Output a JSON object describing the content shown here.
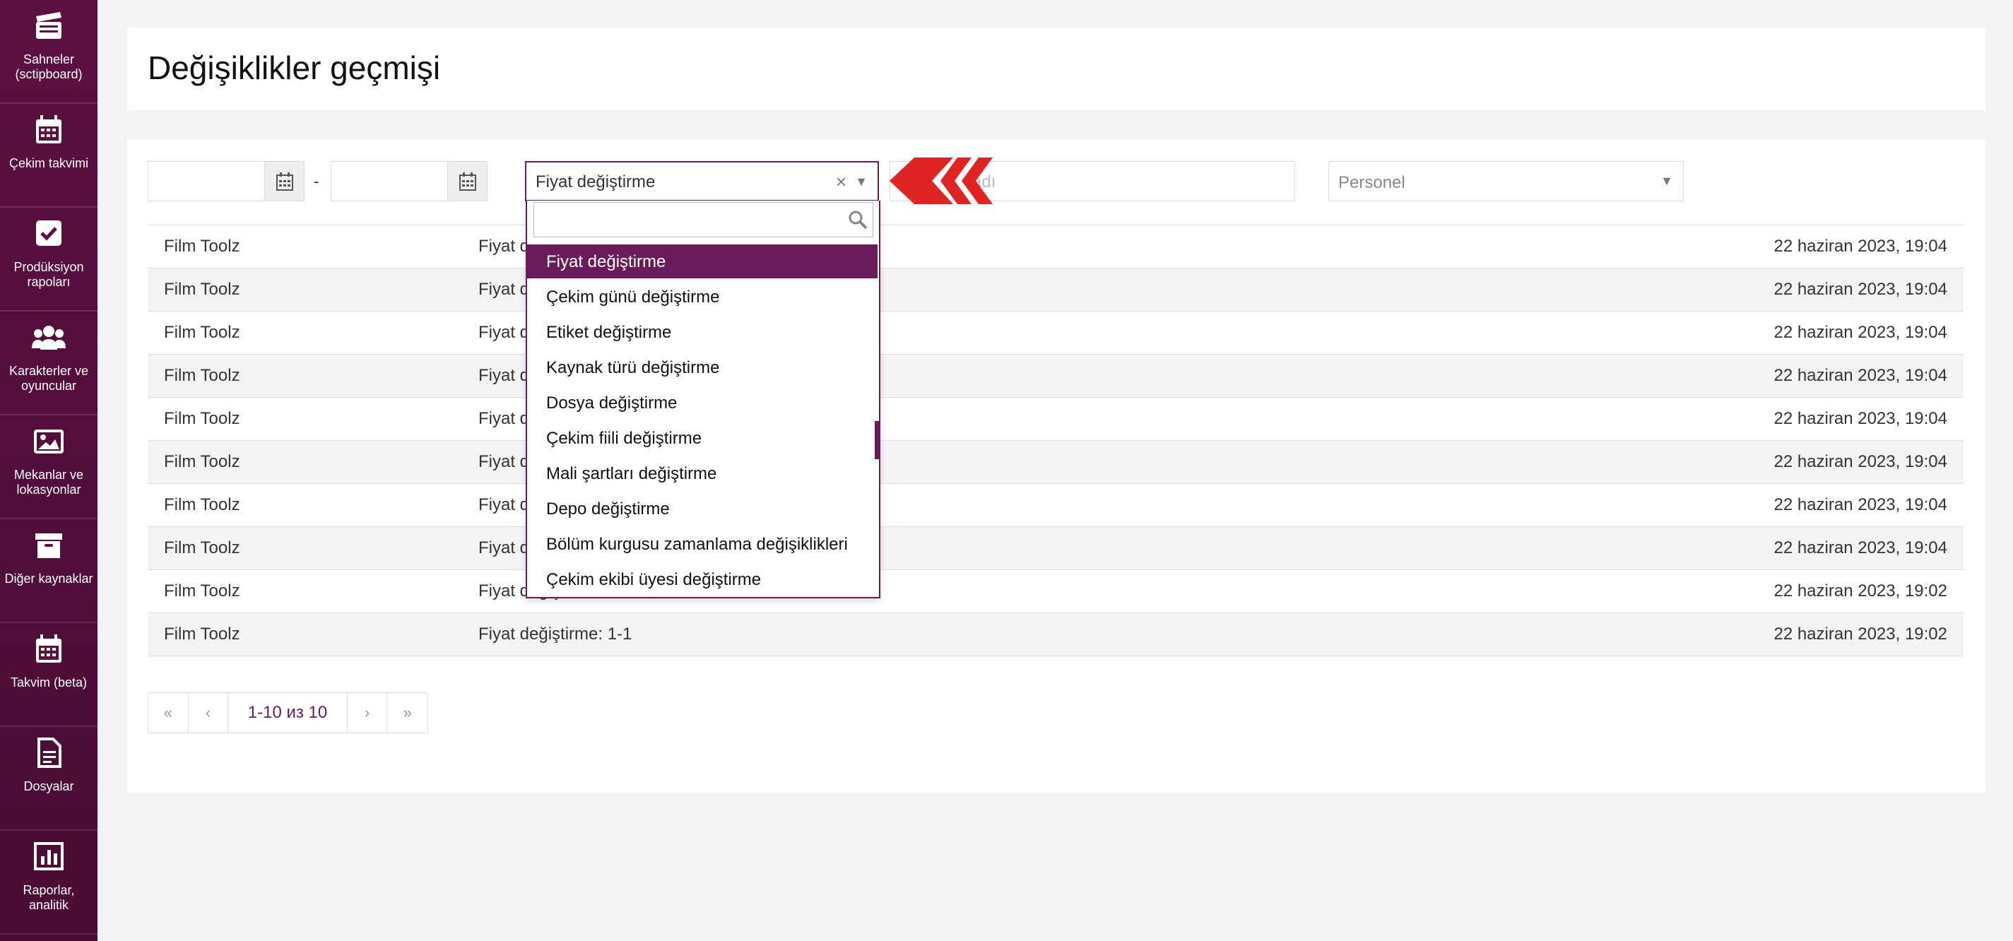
{
  "sidebar": {
    "items": [
      {
        "label": "Sahneler (sctipboard)",
        "icon": "clapperboard-icon"
      },
      {
        "label": "Çekim takvimi",
        "icon": "calendar-icon"
      },
      {
        "label": "Prodüksiyon rapoları",
        "icon": "checkbox-icon"
      },
      {
        "label": "Karakterler ve oyuncular",
        "icon": "users-icon"
      },
      {
        "label": "Mekanlar ve lokasyonlar",
        "icon": "image-icon"
      },
      {
        "label": "Diğer kaynaklar",
        "icon": "archive-box-icon"
      },
      {
        "label": "Takvim (beta)",
        "icon": "calendar-icon"
      },
      {
        "label": "Dosyalar",
        "icon": "document-icon"
      },
      {
        "label": "Raporlar, analitik",
        "icon": "bar-chart-icon"
      }
    ]
  },
  "header": {
    "title": "Değişiklikler geçmişi"
  },
  "filters": {
    "date_from": "",
    "date_separator": "-",
    "date_to": "",
    "type_select_value": "Fiyat değiştirme",
    "location_placeholder": "Mekan adı",
    "location_placeholder_visible": "adı",
    "staff_placeholder": "Personel"
  },
  "table": {
    "rows": [
      {
        "user": "Film Toolz",
        "action": "Fiyat d",
        "date": "22 haziran 2023, 19:04"
      },
      {
        "user": "Film Toolz",
        "action": "Fiyat d",
        "date": "22 haziran 2023, 19:04"
      },
      {
        "user": "Film Toolz",
        "action": "Fiyat d",
        "date": "22 haziran 2023, 19:04"
      },
      {
        "user": "Film Toolz",
        "action": "Fiyat d",
        "date": "22 haziran 2023, 19:04"
      },
      {
        "user": "Film Toolz",
        "action": "Fiyat d",
        "date": "22 haziran 2023, 19:04"
      },
      {
        "user": "Film Toolz",
        "action": "Fiyat d",
        "date": "22 haziran 2023, 19:04"
      },
      {
        "user": "Film Toolz",
        "action": "Fiyat d",
        "date": "22 haziran 2023, 19:04"
      },
      {
        "user": "Film Toolz",
        "action": "Fiyat d",
        "date": "22 haziran 2023, 19:04"
      },
      {
        "user": "Film Toolz",
        "action": "Fiyat değiştirme: 1-1",
        "date": "22 haziran 2023, 19:02"
      },
      {
        "user": "Film Toolz",
        "action": "Fiyat değiştirme: 1-1",
        "date": "22 haziran 2023, 19:02"
      }
    ]
  },
  "pagination": {
    "info": "1-10 из 10"
  },
  "dropdown": {
    "search_value": "",
    "options": [
      "Fiyat değiştirme",
      "Çekim günü değiştirme",
      "Etiket değiştirme",
      "Kaynak türü değiştirme",
      "Dosya değiştirme",
      "Çekim fiili değiştirme",
      "Mali şartları değiştirme",
      "Depo değiştirme",
      "Bölüm kurgusu zamanlama değişiklikleri",
      "Çekim ekibi üyesi değiştirme"
    ],
    "selected_index": 0
  },
  "colors": {
    "brand": "#6a1b5a",
    "sidebar": "#5b1041",
    "annotation": "#e02424"
  }
}
